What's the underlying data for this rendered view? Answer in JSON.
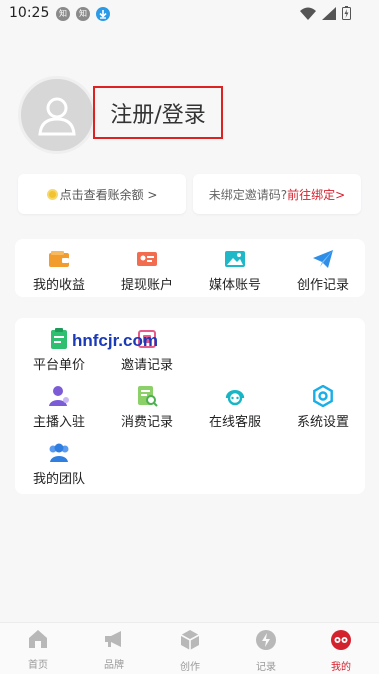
{
  "status_bar": {
    "time": "10:25",
    "notif_1": "知",
    "notif_2": "知"
  },
  "profile": {
    "login_label": "注册/登录"
  },
  "cards": {
    "balance_label": "点击查看账余额 >",
    "invite_label": "未绑定邀请码?",
    "invite_link": "前往绑定>"
  },
  "grid_top": [
    {
      "label": "我的收益",
      "icon": "wallet-icon"
    },
    {
      "label": "提现账户",
      "icon": "id-card-icon"
    },
    {
      "label": "媒体账号",
      "icon": "image-icon"
    },
    {
      "label": "创作记录",
      "icon": "paper-plane-icon"
    }
  ],
  "grid_bottom": [
    {
      "label": "平台单价",
      "icon": "clipboard-icon"
    },
    {
      "label": "邀请记录",
      "icon": "invite-icon"
    },
    {
      "label": "主播入驻",
      "icon": "anchor-user-icon"
    },
    {
      "label": "消费记录",
      "icon": "receipt-search-icon"
    },
    {
      "label": "在线客服",
      "icon": "headset-icon"
    },
    {
      "label": "系统设置",
      "icon": "settings-icon"
    },
    {
      "label": "我的团队",
      "icon": "team-icon"
    }
  ],
  "watermark": "hnfcjr.com",
  "bottom_nav": [
    {
      "label": "首页",
      "icon": "home-icon"
    },
    {
      "label": "品牌",
      "icon": "megaphone-icon"
    },
    {
      "label": "创作",
      "icon": "cube-icon"
    },
    {
      "label": "记录",
      "icon": "lightning-icon"
    },
    {
      "label": "我的",
      "icon": "profile-icon"
    }
  ],
  "colors": {
    "accent_red": "#d4212e",
    "orange": "#f39c2e",
    "blue": "#2f8fe8",
    "green": "#2fbf71",
    "purple": "#7b5bd6"
  }
}
